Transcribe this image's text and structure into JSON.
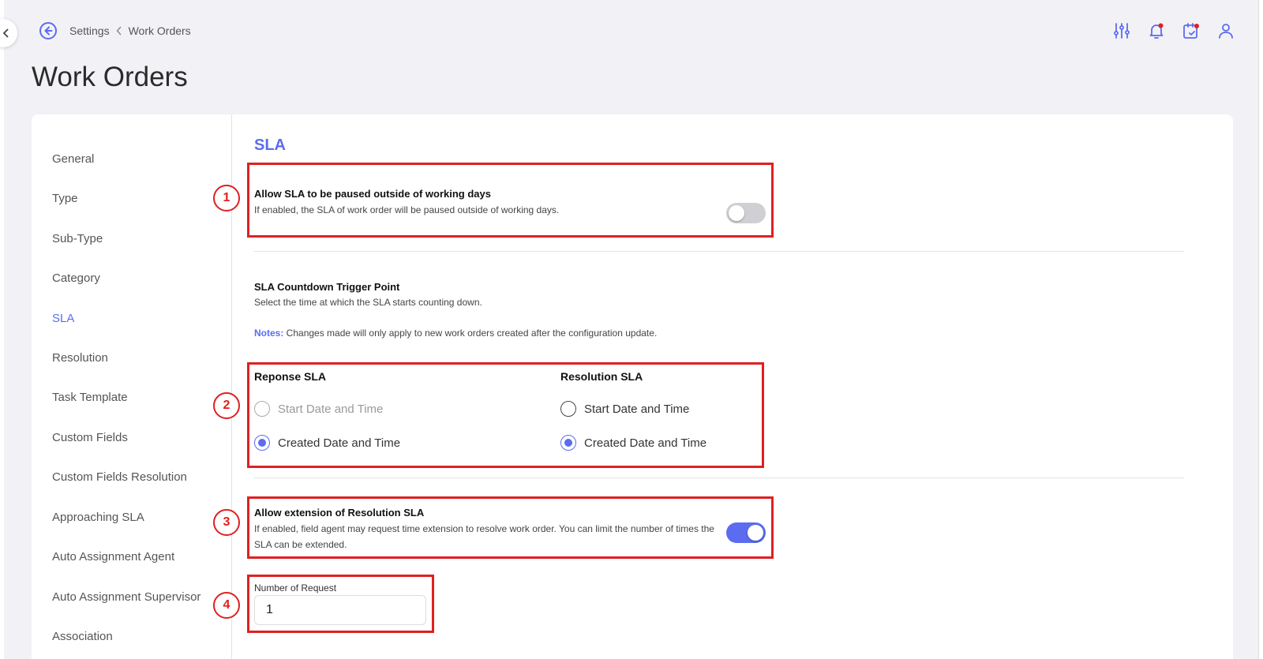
{
  "breadcrumb": {
    "items": [
      "Settings",
      "Work Orders"
    ]
  },
  "page": {
    "title": "Work Orders"
  },
  "sidebar": {
    "items": [
      {
        "label": "General",
        "active": false
      },
      {
        "label": "Type",
        "active": false
      },
      {
        "label": "Sub-Type",
        "active": false
      },
      {
        "label": "Category",
        "active": false
      },
      {
        "label": "SLA",
        "active": true
      },
      {
        "label": "Resolution",
        "active": false
      },
      {
        "label": "Task Template",
        "active": false
      },
      {
        "label": "Custom Fields",
        "active": false
      },
      {
        "label": "Custom Fields Resolution",
        "active": false
      },
      {
        "label": "Approaching SLA",
        "active": false
      },
      {
        "label": "Auto Assignment Agent",
        "active": false
      },
      {
        "label": "Auto Assignment Supervisor",
        "active": false
      },
      {
        "label": "Association",
        "active": false
      }
    ]
  },
  "sla": {
    "section_title": "SLA",
    "pause": {
      "title": "Allow SLA to be paused outside of working days",
      "description": "If enabled, the SLA of work order will be paused outside of working days.",
      "enabled": false
    },
    "trigger": {
      "title": "SLA Countdown Trigger Point",
      "description": "Select the time at which the SLA starts counting down.",
      "notes_label": "Notes:",
      "notes_text": " Changes made will only apply to new work orders created after the configuration update."
    },
    "response_sla": {
      "label": "Reponse SLA",
      "options": [
        "Start Date and Time",
        "Created Date and Time"
      ],
      "selected": "Created Date and Time"
    },
    "resolution_sla": {
      "label": "Resolution SLA",
      "options": [
        "Start Date and Time",
        "Created Date and Time"
      ],
      "selected": "Created Date and Time"
    },
    "extension": {
      "title": "Allow extension of Resolution SLA",
      "description": "If enabled, field agent may request time extension to resolve work order. You can limit the number of times the SLA can be extended.",
      "enabled": true
    },
    "number_of_request": {
      "label": "Number of Request",
      "value": "1"
    }
  },
  "annotations": [
    "1",
    "2",
    "3",
    "4"
  ],
  "colors": {
    "accent": "#5b6cf0",
    "highlight": "#e02020",
    "toggle_off": "#cfcfd4"
  },
  "icons": [
    "chevron-left-icon",
    "back-circle-icon",
    "sliders-icon",
    "bell-icon",
    "calendar-check-icon",
    "user-icon"
  ]
}
